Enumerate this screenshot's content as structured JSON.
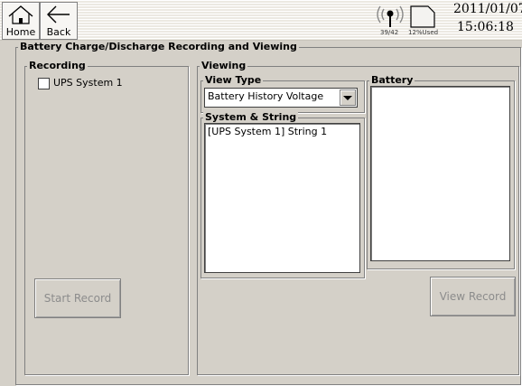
{
  "toolbar": {
    "home_label": "Home",
    "back_label": "Back",
    "signal_count": "39/42",
    "storage_used": "12%Used",
    "date": "2011/01/07",
    "time": "15:06:18"
  },
  "main": {
    "title": "Battery Charge/Discharge Recording and Viewing",
    "recording": {
      "title": "Recording",
      "checkbox_label": "UPS System 1",
      "checkbox_checked": false,
      "start_button": "Start Record"
    },
    "viewing": {
      "title": "Viewing",
      "view_type_title": "View Type",
      "view_type_value": "Battery History Voltage",
      "system_string_title": "System & String",
      "system_string_items": [
        "[UPS System 1] String 1"
      ],
      "battery_title": "Battery",
      "view_button": "View Record"
    }
  },
  "colors": {
    "background": "#d4d0c8",
    "disabled_text": "#8c8c8c"
  }
}
